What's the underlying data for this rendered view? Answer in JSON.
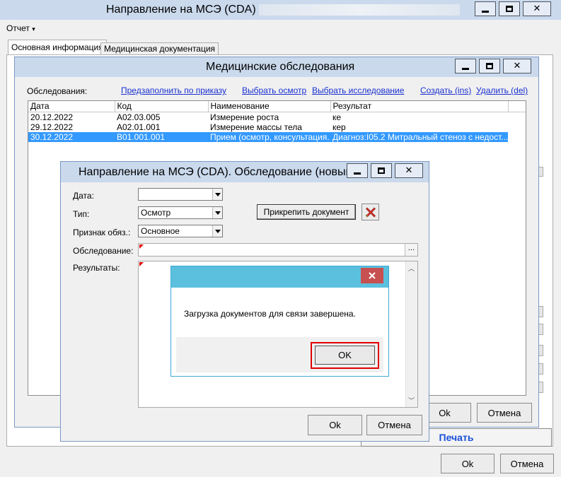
{
  "main_window": {
    "title": "Направление на МСЭ (CDA) -",
    "menu_report": "Отчет",
    "tabs": [
      "Основная информация",
      "Медицинская документация"
    ],
    "print_label": "Печать",
    "ok_label": "Ok",
    "cancel_label": "Отмена"
  },
  "exams_window": {
    "title": "Медицинские обследования",
    "exams_label": "Обследования:",
    "links": {
      "prefill": "Предзаполнить по приказу",
      "choose_exam": "Выбрать осмотр",
      "choose_study": "Выбрать исследование",
      "create": "Создать (ins)",
      "delete": "Удалить (del)"
    },
    "columns": [
      "Дата",
      "Код",
      "Наименование",
      "Результат"
    ],
    "rows": [
      {
        "date": "20.12.2022",
        "code": "A02.03.005",
        "name": "Измерение роста",
        "result": "ке"
      },
      {
        "date": "29.12.2022",
        "code": "A02.01.001",
        "name": "Измерение массы тела",
        "result": "кер"
      },
      {
        "date": "30.12.2022",
        "code": "B01.001.001",
        "name": "Прием (осмотр, консультация...",
        "result": "Диагноз:I05.2 Митральный стеноз с недост..."
      }
    ],
    "ok_label": "Ok",
    "cancel_label": "Отмена"
  },
  "exam_dialog": {
    "title": "Направление на МСЭ (CDA). Обследование (новый)",
    "date_label": "Дата:",
    "date_value": "",
    "type_label": "Тип:",
    "type_value": "Осмотр",
    "required_label": "Признак обяз.:",
    "required_value": "Основное",
    "exam_label": "Обследование:",
    "exam_value": "",
    "browse_label": "...",
    "results_label": "Результаты:",
    "attach_label": "Прикрепить документ",
    "ok_label": "Ok",
    "cancel_label": "Отмена"
  },
  "message_box": {
    "text": "Загрузка документов для связи завершена.",
    "ok_label": "OK",
    "highlight_color": "#e00000"
  },
  "colors": {
    "titlebar": "#cad9ec",
    "msg_titlebar": "#5bc0de",
    "selection": "#3399ff",
    "link": "#1a31d0",
    "close_hover": "#c75050"
  }
}
